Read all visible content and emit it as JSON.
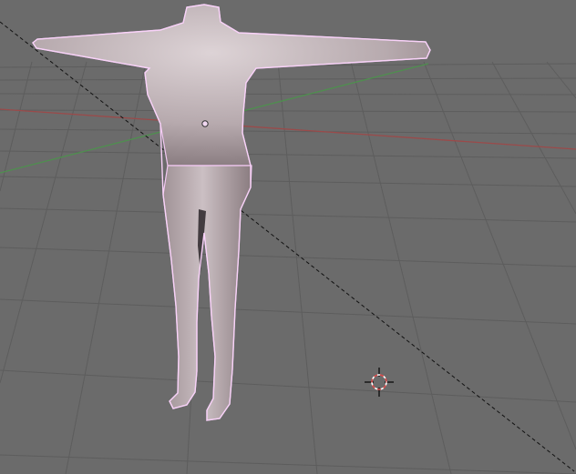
{
  "viewport": {
    "background_color": "#6b6b6b",
    "grid_color": "#5d5d5d",
    "x_axis_color": "#9b4a4a",
    "y_axis_color": "#4f8f4f",
    "selection_outline_color": "#f0c8f0",
    "mesh_color": "#b9a9ad",
    "cursor_colors": {
      "ring_red": "#d84c4c",
      "ring_white": "#ffffff",
      "crosshair": "#111111"
    },
    "icons": {
      "cursor": "3d-cursor-icon",
      "origin": "object-origin-icon"
    }
  }
}
